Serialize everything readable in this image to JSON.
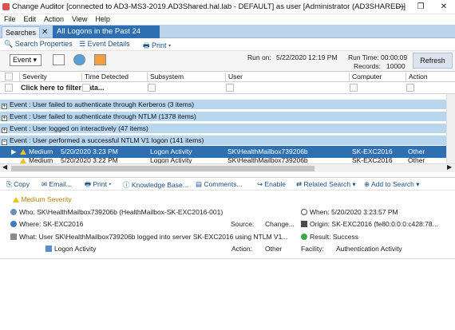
{
  "window": {
    "title": "Change Auditor [connected to AD3-MS3-2019.AD3Shared.hal.lab - DEFAULT] as user [Administrator (AD3SHARED)]",
    "min": "—",
    "max": "❐",
    "close": "✕"
  },
  "menu": [
    "File",
    "Edit",
    "Action",
    "View",
    "Help"
  ],
  "tabs": {
    "searches": "Searches",
    "active": "All Logons in the Past 24 hours",
    "close": "✕"
  },
  "toolbar": {
    "search_properties": "Search Properties",
    "event_details": "Event Details",
    "print": "Print ▾"
  },
  "run": {
    "event_dropdown": "Event ▾",
    "run_on_label": "Run on:",
    "run_on_value": "5/22/2020 12:19 PM",
    "run_time_label": "Run Time:",
    "run_time_value": "00:00:09",
    "records_label": "Records:",
    "records_value": "10000",
    "refresh": "Refresh"
  },
  "columns": [
    "Severity",
    "Time Detected",
    "Subsystem",
    "User",
    "Computer",
    "Action"
  ],
  "filter_text": "Click here to filter data...",
  "groups": [
    "Event : User failed to authenticate through Kerberos (3 items)",
    "Event : User failed to authenticate through NTLM (1378 items)",
    "Event : User logged on interactively (47 items)",
    "Event : User performed a successful NTLM V1 logon (141 items)"
  ],
  "rows": [
    {
      "severity": "Medium",
      "time": "5/20/2020 3:23 PM",
      "subsystem": "Logon Activity",
      "user": "SK\\HealthMailbox739206b",
      "computer": "SK-EXC2016",
      "action": "Other"
    },
    {
      "severity": "Medium",
      "time": "5/20/2020 3:22 PM",
      "subsystem": "Logon Activity",
      "user": "SK\\HealthMailbox739206b",
      "computer": "SK-EXC2016",
      "action": "Other"
    }
  ],
  "details_toolbar": {
    "copy": "Copy",
    "email": "Email...",
    "print": "Print ▾",
    "kb": "Knowledge Base...",
    "comments": "Comments...",
    "enable": "Enable",
    "related": "Related Search ▾",
    "add": "Add to Search ▾"
  },
  "details": {
    "severity": "Medium Severity",
    "who_label": "Who:",
    "who_value": "SK\\HealthMailbox739206b  (HealthMailbox-SK-EXC2016-001)",
    "where_label": "Where:",
    "where_value": "SK-EXC2016",
    "source_label": "Source:",
    "source_value": "Change...",
    "what_label": "What:",
    "what_value": "User SK\\HealthMailbox739206b logged into server SK-EXC2016 using NTLM V1...",
    "subsystem": "Logon Activity",
    "action_label": "Action:",
    "action_value": "Other",
    "when_label": "When:",
    "when_value": "5/20/2020 3:23:57 PM",
    "origin_label": "Origin:",
    "origin_value": "SK-EXC2016  (fe80:0:0:0:c428:78...",
    "result_label": "Result:",
    "result_value": "Success",
    "facility_label": "Facility:",
    "facility_value": "Authentication Activity"
  },
  "colors": {
    "tab_active": "#2d6fb1",
    "group_bg": "#b9d6ef",
    "selected_row": "#2d6fb1",
    "warn": "#f1c21b",
    "success": "#3aa844"
  }
}
